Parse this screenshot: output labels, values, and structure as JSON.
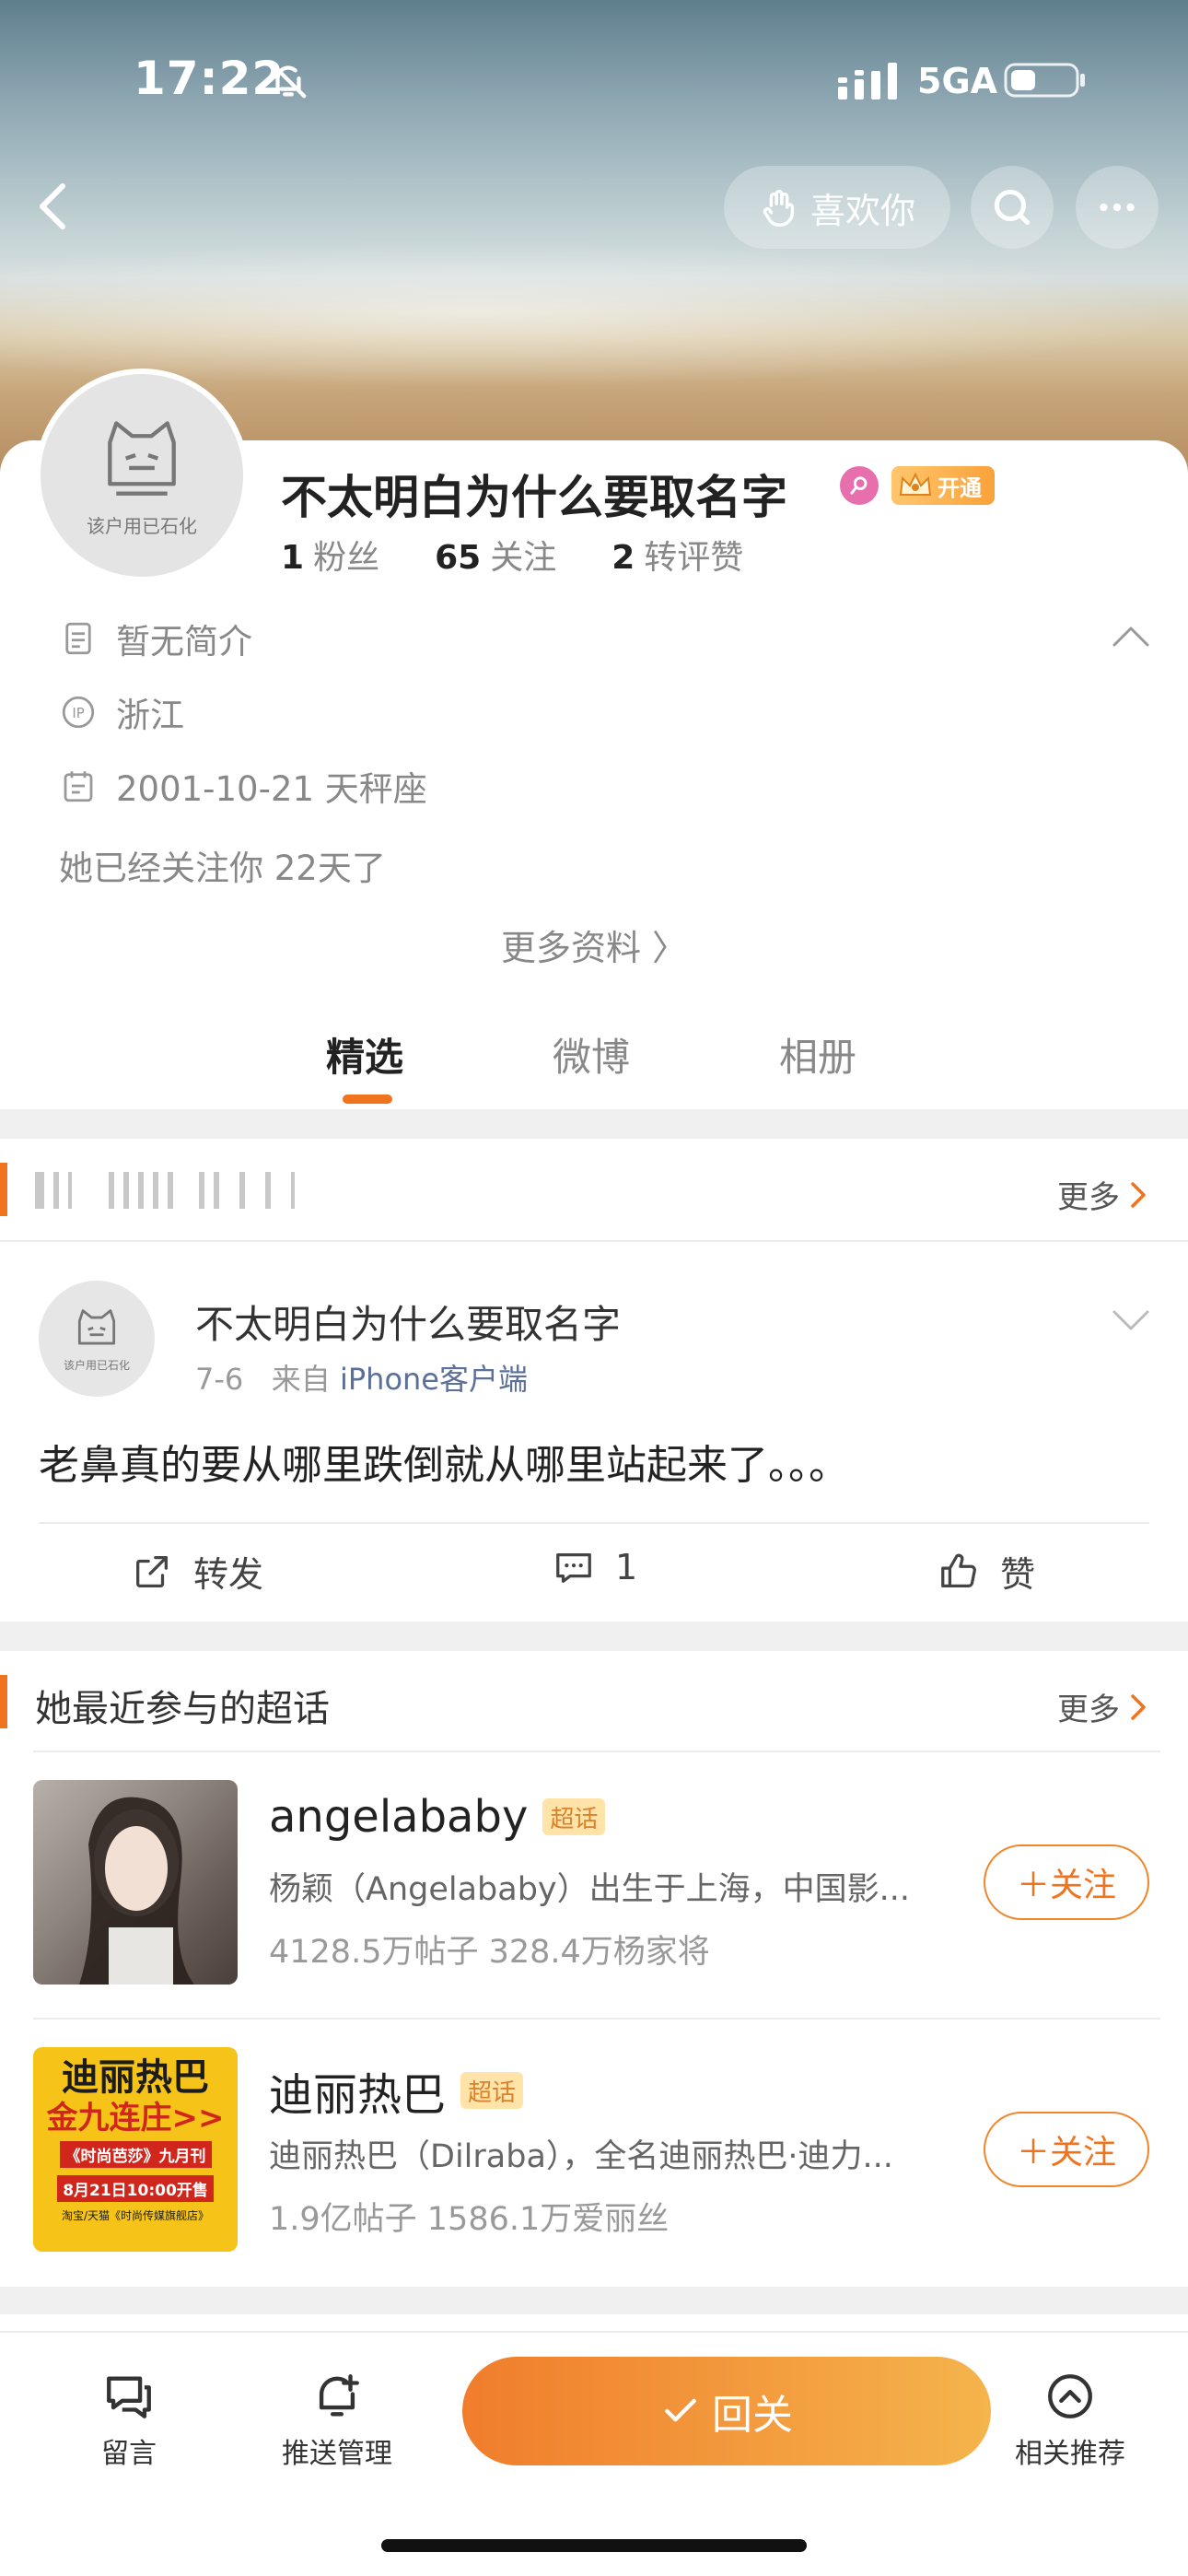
{
  "status_bar": {
    "time": "17:22",
    "network": "5GA"
  },
  "header": {
    "like_label": "喜欢你"
  },
  "profile": {
    "avatar_text": "该户用已石化",
    "name": "不太明白为什么要取名字",
    "vip_label": "开通",
    "stats": [
      {
        "value": "1",
        "label": "粉丝"
      },
      {
        "value": "65",
        "label": "关注"
      },
      {
        "value": "2",
        "label": "转评赞"
      }
    ],
    "bio": "暂无简介",
    "ip_location": "浙江",
    "birthday": "2001-10-21 天秤座",
    "follow_days": "她已经关注你 22天了",
    "more_info": "更多资料 〉"
  },
  "tabs": [
    "精选",
    "微博",
    "相册"
  ],
  "featured_section": {
    "more_label": "更多"
  },
  "post": {
    "avatar_text": "该户用已石化",
    "author": "不太明白为什么要取名字",
    "date": "7-6",
    "from_prefix": "来自",
    "source": "iPhone客户端",
    "text": "老鼻真的要从哪里跌倒就从哪里站起来了。。。",
    "repost_label": "转发",
    "comment_count": "1",
    "like_label": "赞"
  },
  "supertopics": {
    "title": "她最近参与的超话",
    "more_label": "更多",
    "badge": "超话",
    "follow_label": "＋关注",
    "items": [
      {
        "name": "angelababy",
        "desc": "杨颖（Angelababy）出生于上海，中国影...",
        "stats": "4128.5万帖子 328.4万杨家将"
      },
      {
        "name": "迪丽热巴",
        "desc": "迪丽热巴（Dilraba），全名迪丽热巴·迪力...",
        "stats": "1.9亿帖子 1586.1万爱丽丝",
        "poster_lines": [
          "迪丽热巴",
          "金九连庄>>",
          "《时尚芭莎》九月刊",
          "8月21日10:00开售",
          "淘宝/天猫《时尚传媒旗舰店》"
        ]
      }
    ]
  },
  "bottom_bar": {
    "message_label": "留言",
    "push_label": "推送管理",
    "reply_label": "回关",
    "recommend_label": "相关推荐"
  },
  "colors": {
    "accent": "#f0731e",
    "link": "#5b6f99",
    "badge_bg": "#ffe3a8"
  }
}
